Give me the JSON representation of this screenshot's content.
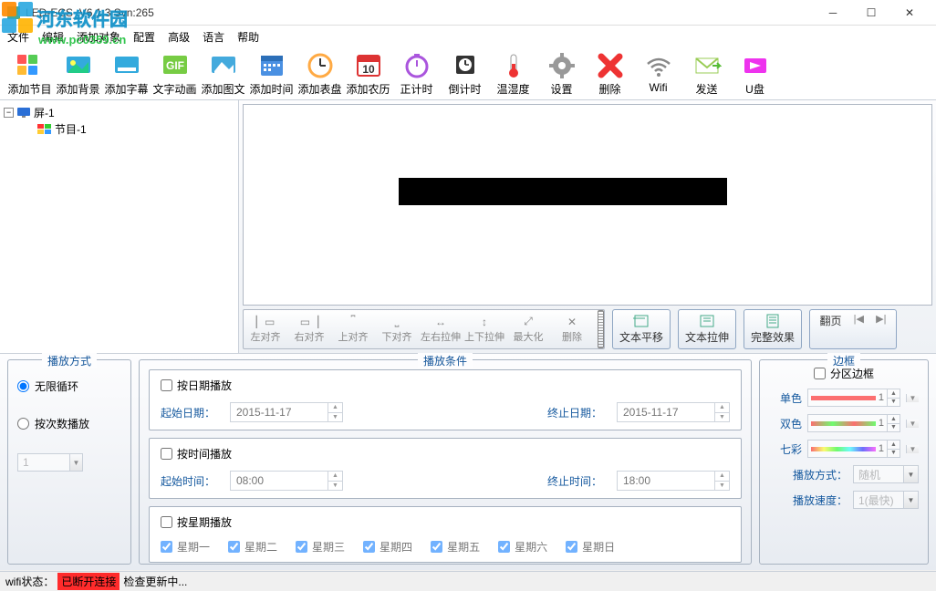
{
  "window": {
    "title": "LED-ECS_V6.1.3 Svn:265"
  },
  "watermark": {
    "site": "河东软件园",
    "url": "www.pc0359.cn"
  },
  "menu": {
    "file": "文件",
    "edit": "编辑",
    "addobj": "添加对象",
    "config": "配置",
    "advanced": "高级",
    "language": "语言",
    "help": "帮助"
  },
  "toolbar": {
    "addprog": "添加节目",
    "addbg": "添加背景",
    "addsub": "添加字幕",
    "textanim": "文字动画",
    "addimg": "添加图文",
    "addtime": "添加时间",
    "adddial": "添加表盘",
    "addlunar": "添加农历",
    "countup": "正计时",
    "countdown": "倒计时",
    "temphum": "温湿度",
    "settings": "设置",
    "delete": "删除",
    "wifi": "Wifi",
    "send": "发送",
    "udisk": "U盘"
  },
  "tree": {
    "screen": "屏-1",
    "program": "节目-1"
  },
  "align": {
    "l": "左对齐",
    "r": "右对齐",
    "t": "上对齐",
    "b": "下对齐",
    "sh": "左右拉伸",
    "sv": "上下拉伸",
    "max": "最大化",
    "del": "删除"
  },
  "textops": {
    "shift": "文本平移",
    "stretch": "文本拉伸",
    "effect": "完整效果",
    "page": "翻页"
  },
  "playmode": {
    "legend": "播放方式",
    "loop": "无限循环",
    "count": "按次数播放",
    "countval": "1"
  },
  "playcond": {
    "legend": "播放条件",
    "bydate": "按日期播放",
    "startdate": "起始日期：",
    "startdate_v": "2015-11-17",
    "enddate": "终止日期：",
    "enddate_v": "2015-11-17",
    "bytime": "按时间播放",
    "starttime": "起始时间：",
    "starttime_v": "08:00",
    "endtime": "终止时间：",
    "endtime_v": "18:00",
    "byweek": "按星期播放",
    "w1": "星期一",
    "w2": "星期二",
    "w3": "星期三",
    "w4": "星期四",
    "w5": "星期五",
    "w6": "星期六",
    "w7": "星期日"
  },
  "border": {
    "legend": "边框",
    "partition": "分区边框",
    "single": "单色",
    "dual": "双色",
    "rainbow": "七彩",
    "mode": "播放方式：",
    "mode_v": "随机",
    "speed": "播放速度：",
    "speed_v": "1(最快)",
    "num": "1"
  },
  "status": {
    "wifi": "wifi状态：",
    "disc": "已断开连接",
    "check": "检查更新中..."
  }
}
